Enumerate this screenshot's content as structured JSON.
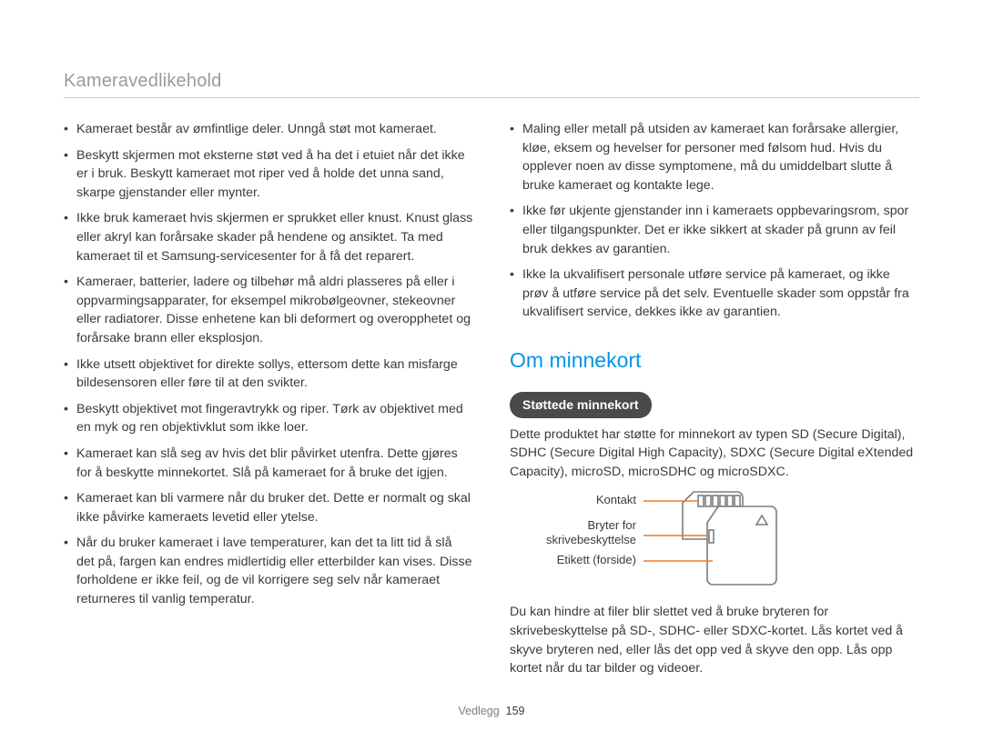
{
  "header": {
    "title": "Kameravedlikehold"
  },
  "left": {
    "bullets": [
      "Kameraet består av ømfintlige deler. Unngå støt mot kameraet.",
      "Beskytt skjermen mot eksterne støt ved å ha det i etuiet når det ikke er i bruk. Beskytt kameraet mot riper ved å holde det unna sand, skarpe gjenstander eller mynter.",
      "Ikke bruk kameraet hvis skjermen er sprukket eller knust. Knust glass eller akryl kan forårsake skader på hendene og ansiktet. Ta med kameraet til et Samsung-servicesenter for å få det reparert.",
      "Kameraer, batterier, ladere og tilbehør må aldri plasseres på eller i oppvarmingsapparater, for eksempel mikrobølgeovner, stekeovner eller radiatorer. Disse enhetene kan bli deformert og overopphetet og forårsake brann eller eksplosjon.",
      "Ikke utsett objektivet for direkte sollys, ettersom dette kan misfarge bildesensoren eller føre til at den svikter.",
      "Beskytt objektivet mot fingeravtrykk og riper. Tørk av objektivet med en myk og ren objektivklut som ikke loer.",
      "Kameraet kan slå seg av hvis det blir påvirket utenfra. Dette gjøres for å beskytte minnekortet. Slå på kameraet for å bruke det igjen.",
      "Kameraet kan bli varmere når du bruker det. Dette er normalt og skal ikke påvirke kameraets levetid eller ytelse.",
      "Når du bruker kameraet i lave temperaturer, kan det ta litt tid å slå det på, fargen kan endres midlertidig eller etterbilder kan vises. Disse forholdene er ikke feil, og de vil korrigere seg selv når kameraet returneres til vanlig temperatur."
    ]
  },
  "right": {
    "bullets": [
      "Maling eller metall på utsiden av kameraet kan forårsake allergier, kløe, eksem og hevelser for personer med følsom hud. Hvis du opplever noen av disse symptomene, må du umiddelbart slutte å bruke kameraet og kontakte lege.",
      "Ikke før ukjente gjenstander inn i kameraets oppbevaringsrom, spor eller tilgangspunkter. Det er ikke sikkert at skader på grunn av feil bruk dekkes av garantien.",
      "Ikke la ukvalifisert personale utføre service på kameraet, og ikke prøv å utføre service på det selv. Eventuelle skader som oppstår fra ukvalifisert service, dekkes ikke av garantien."
    ],
    "section_title": "Om minnekort",
    "pill": "Støttede minnekort",
    "para1": "Dette produktet har støtte for minnekort av typen SD (Secure Digital), SDHC (Secure Digital High Capacity), SDXC (Secure Digital eXtended Capacity), microSD, microSDHC og microSDXC.",
    "sd_labels": {
      "contact": "Kontakt",
      "switch_line1": "Bryter for",
      "switch_line2": "skrivebeskyttelse",
      "label_front": "Etikett (forside)"
    },
    "para2": "Du kan hindre at filer blir slettet ved å bruke bryteren for skrivebeskyttelse på SD-, SDHC- eller SDXC-kortet. Lås kortet ved å skyve bryteren ned, eller lås det opp ved å skyve den opp. Lås opp kortet når du tar bilder og videoer."
  },
  "footer": {
    "section": "Vedlegg",
    "page": "159"
  }
}
